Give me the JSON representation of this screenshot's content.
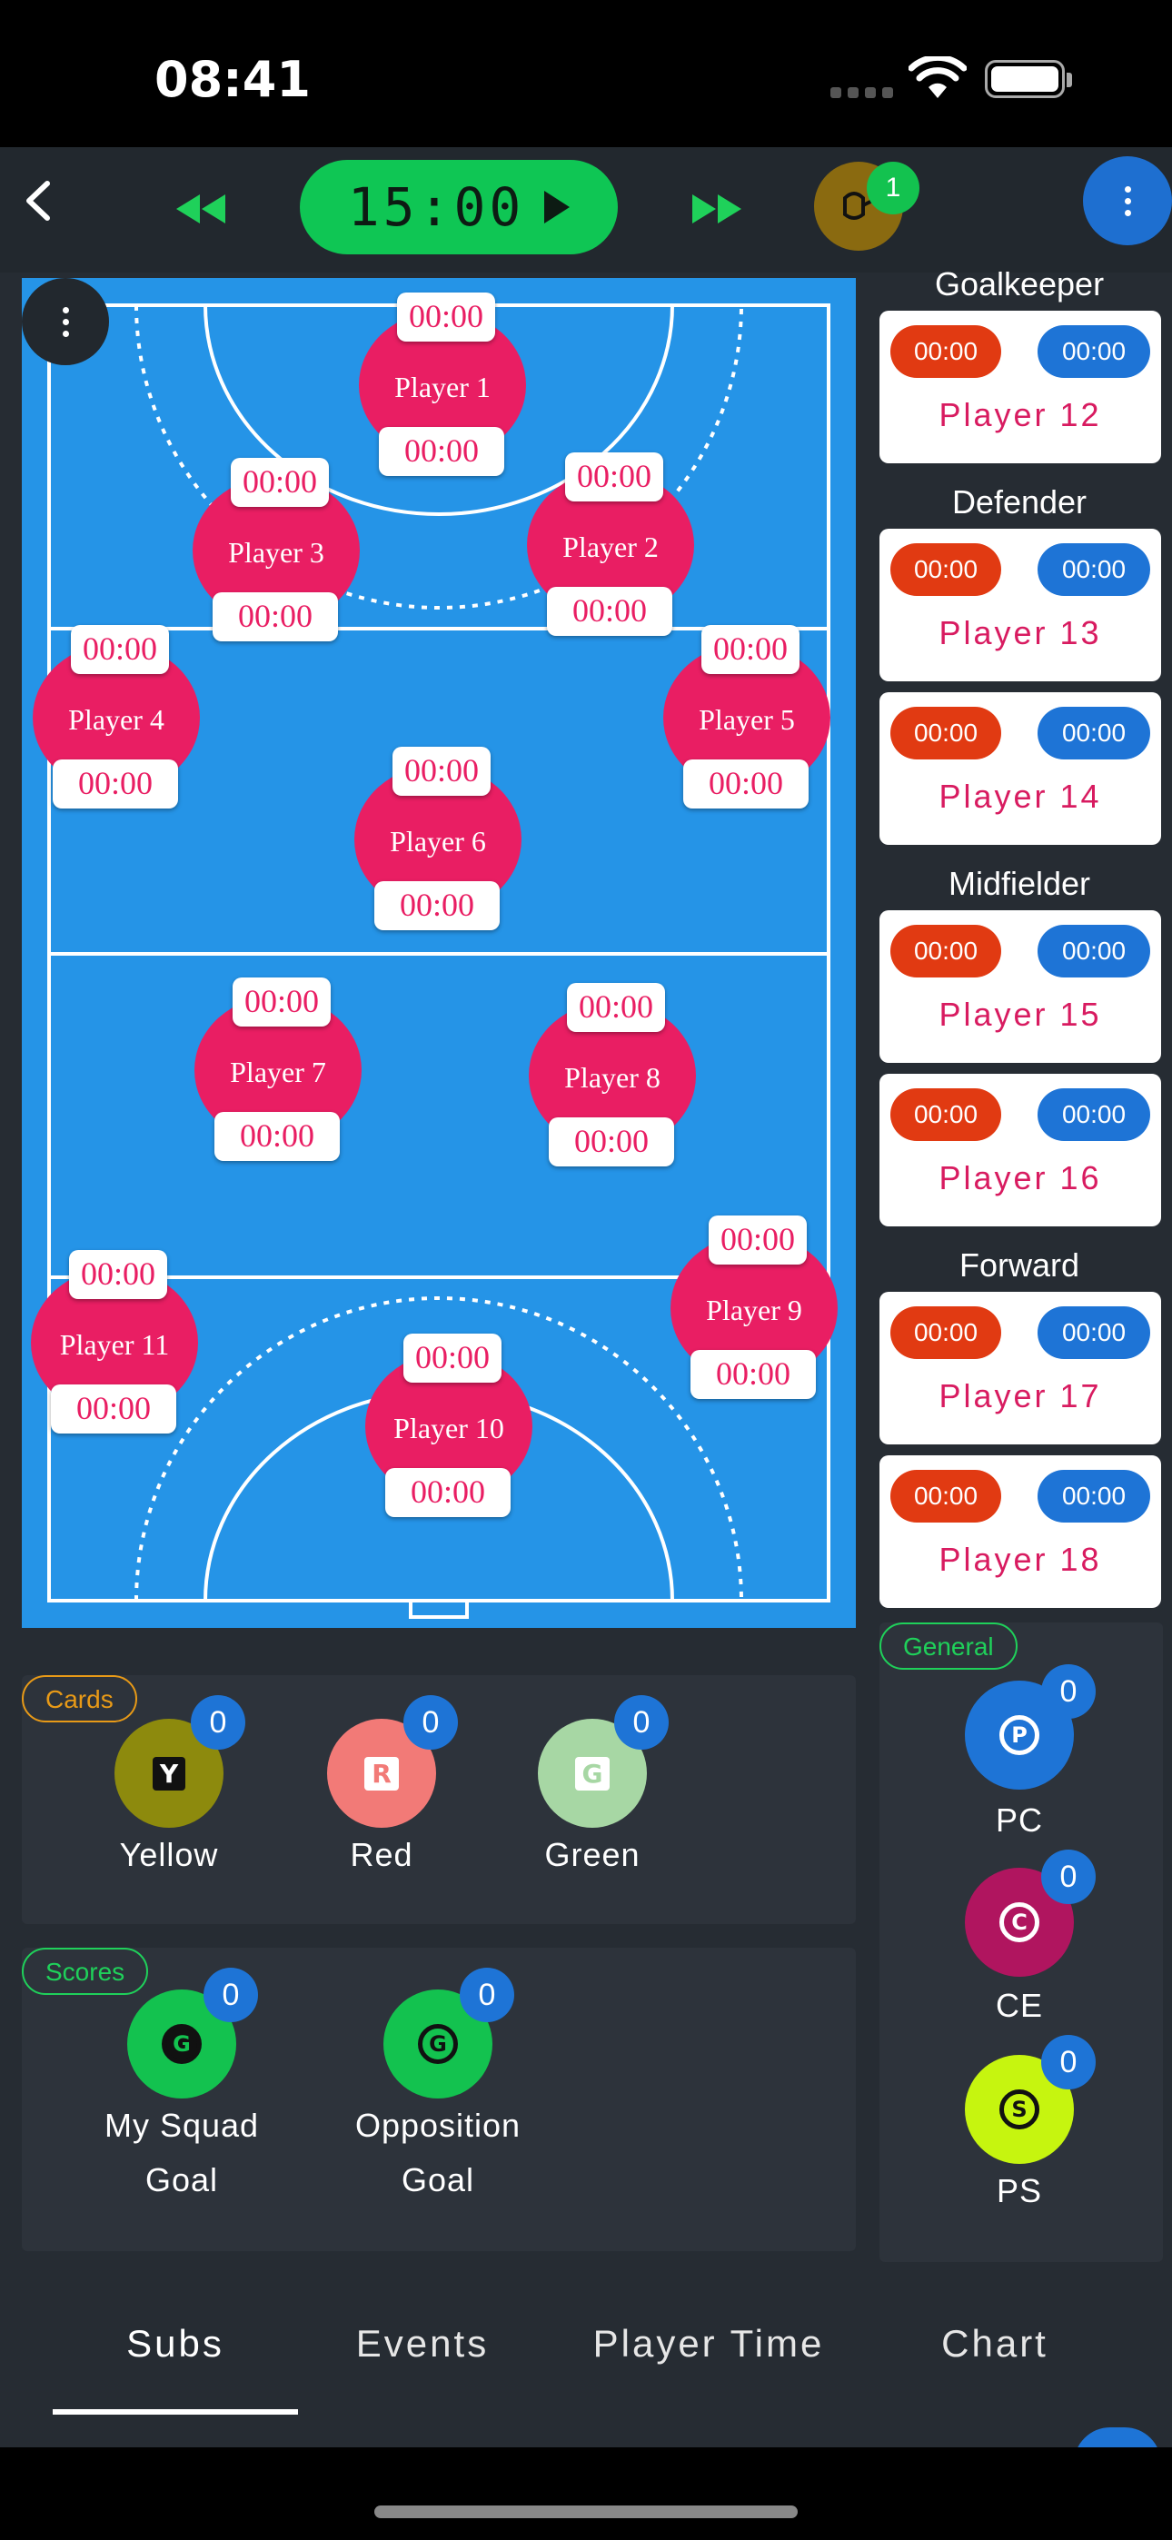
{
  "status_bar": {
    "time": "08:41"
  },
  "header": {
    "timer": "15:00",
    "sub_count": "1"
  },
  "players": [
    {
      "name": "Player 1",
      "time_top": "00:00",
      "time_bottom": "00:00"
    },
    {
      "name": "Player 2",
      "time_top": "00:00",
      "time_bottom": "00:00"
    },
    {
      "name": "Player 3",
      "time_top": "00:00",
      "time_bottom": "00:00"
    },
    {
      "name": "Player 4",
      "time_top": "00:00",
      "time_bottom": "00:00"
    },
    {
      "name": "Player 5",
      "time_top": "00:00",
      "time_bottom": "00:00"
    },
    {
      "name": "Player 6",
      "time_top": "00:00",
      "time_bottom": "00:00"
    },
    {
      "name": "Player 7",
      "time_top": "00:00",
      "time_bottom": "00:00"
    },
    {
      "name": "Player 8",
      "time_top": "00:00",
      "time_bottom": "00:00"
    },
    {
      "name": "Player 9",
      "time_top": "00:00",
      "time_bottom": "00:00"
    },
    {
      "name": "Player 10",
      "time_top": "00:00",
      "time_bottom": "00:00"
    },
    {
      "name": "Player 11",
      "time_top": "00:00",
      "time_bottom": "00:00"
    }
  ],
  "bench": {
    "groups": [
      {
        "label": "Goalkeeper"
      },
      {
        "label": "Defender"
      },
      {
        "label": "Midfielder"
      },
      {
        "label": "Forward"
      }
    ],
    "players": [
      {
        "name": "Player 12",
        "red": "00:00",
        "blue": "00:00"
      },
      {
        "name": "Player 13",
        "red": "00:00",
        "blue": "00:00"
      },
      {
        "name": "Player 14",
        "red": "00:00",
        "blue": "00:00"
      },
      {
        "name": "Player 15",
        "red": "00:00",
        "blue": "00:00"
      },
      {
        "name": "Player 16",
        "red": "00:00",
        "blue": "00:00"
      },
      {
        "name": "Player 17",
        "red": "00:00",
        "blue": "00:00"
      },
      {
        "name": "Player 18",
        "red": "00:00",
        "blue": "00:00"
      }
    ]
  },
  "cards": {
    "title": "Cards",
    "items": [
      {
        "label": "Yellow",
        "glyph": "Y",
        "count": "0",
        "color": "#8d8a0d"
      },
      {
        "label": "Red",
        "glyph": "R",
        "count": "0",
        "color": "#f27a77"
      },
      {
        "label": "Green",
        "glyph": "G",
        "count": "0",
        "color": "#a7d7a4"
      }
    ]
  },
  "scores": {
    "title": "Scores",
    "items": [
      {
        "label_1": "My Squad",
        "label_2": "Goal",
        "glyph": "G",
        "count": "0"
      },
      {
        "label_1": "Opposition",
        "label_2": "Goal",
        "glyph": "G",
        "count": "0"
      }
    ]
  },
  "general": {
    "title": "General",
    "items": [
      {
        "label": "PC",
        "glyph": "P",
        "count": "0",
        "color": "#1e74d6"
      },
      {
        "label": "CE",
        "glyph": "C",
        "count": "0",
        "color": "#b0155f"
      },
      {
        "label": "PS",
        "glyph": "S",
        "count": "0",
        "color": "#c6f50f"
      }
    ]
  },
  "tabs": [
    "Subs",
    "Events",
    "Player Time",
    "Chart"
  ],
  "colors": {
    "court": "#2594e7",
    "player": "#e91e63",
    "accent_green": "#0fc654",
    "accent_blue": "#1e74d6"
  },
  "icons": [
    "back-arrow-icon",
    "rewind-icon",
    "play-icon",
    "fast-forward-icon",
    "substitution-icon",
    "more-vert-icon",
    "wifi-icon",
    "battery-icon"
  ]
}
